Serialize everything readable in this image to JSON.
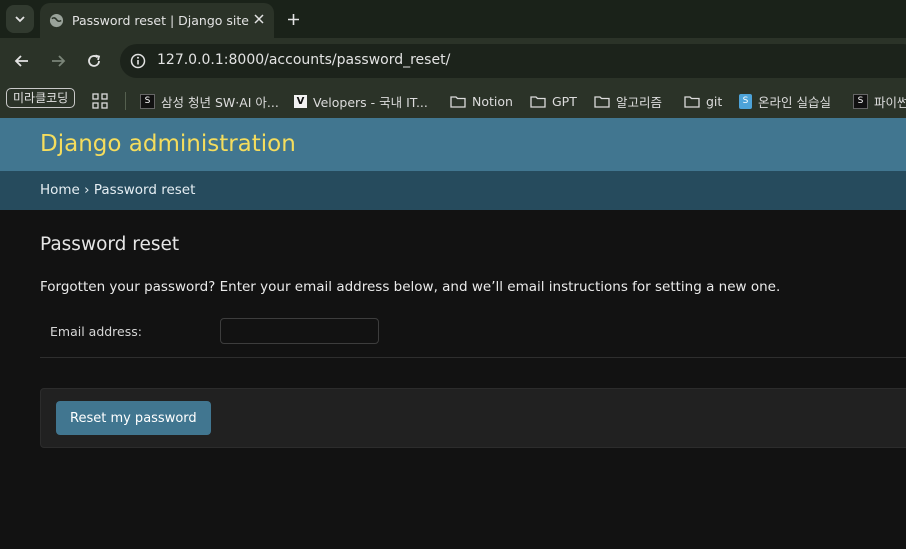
{
  "browser": {
    "tab_title": "Password reset | Django site admin",
    "url": "127.0.0.1:8000/accounts/password_reset/",
    "bookmarks": {
      "pill": "미라클코딩",
      "items": [
        {
          "label": "삼성 청년 SW·AI 아...",
          "icon": "square-s-icon"
        },
        {
          "label": "Velopers - 국내 IT...",
          "icon": "velopers-icon"
        },
        {
          "label": "Notion",
          "icon": "folder-icon"
        },
        {
          "label": "GPT",
          "icon": "folder-icon"
        },
        {
          "label": "알고리즘",
          "icon": "folder-icon"
        },
        {
          "label": "git",
          "icon": "folder-icon"
        },
        {
          "label": "온라인 실습실",
          "icon": "blue-s-icon"
        },
        {
          "label": "파이썬",
          "icon": "square-s-icon"
        }
      ]
    }
  },
  "admin": {
    "branding": "Django administration",
    "breadcrumb_home": "Home",
    "breadcrumb_sep": " › ",
    "breadcrumb_current": "Password reset",
    "page_title": "Password reset",
    "help_text": "Forgotten your password? Enter your email address below, and we’ll email instructions for setting a new one.",
    "email_label": "Email address:",
    "email_value": "",
    "submit_label": "Reset my password"
  },
  "colors": {
    "header_bg": "#417690",
    "branding_text": "#f5dd5d",
    "breadcrumbs_bg": "#264b5d",
    "body_bg": "#121212",
    "button_bg": "#417690"
  }
}
